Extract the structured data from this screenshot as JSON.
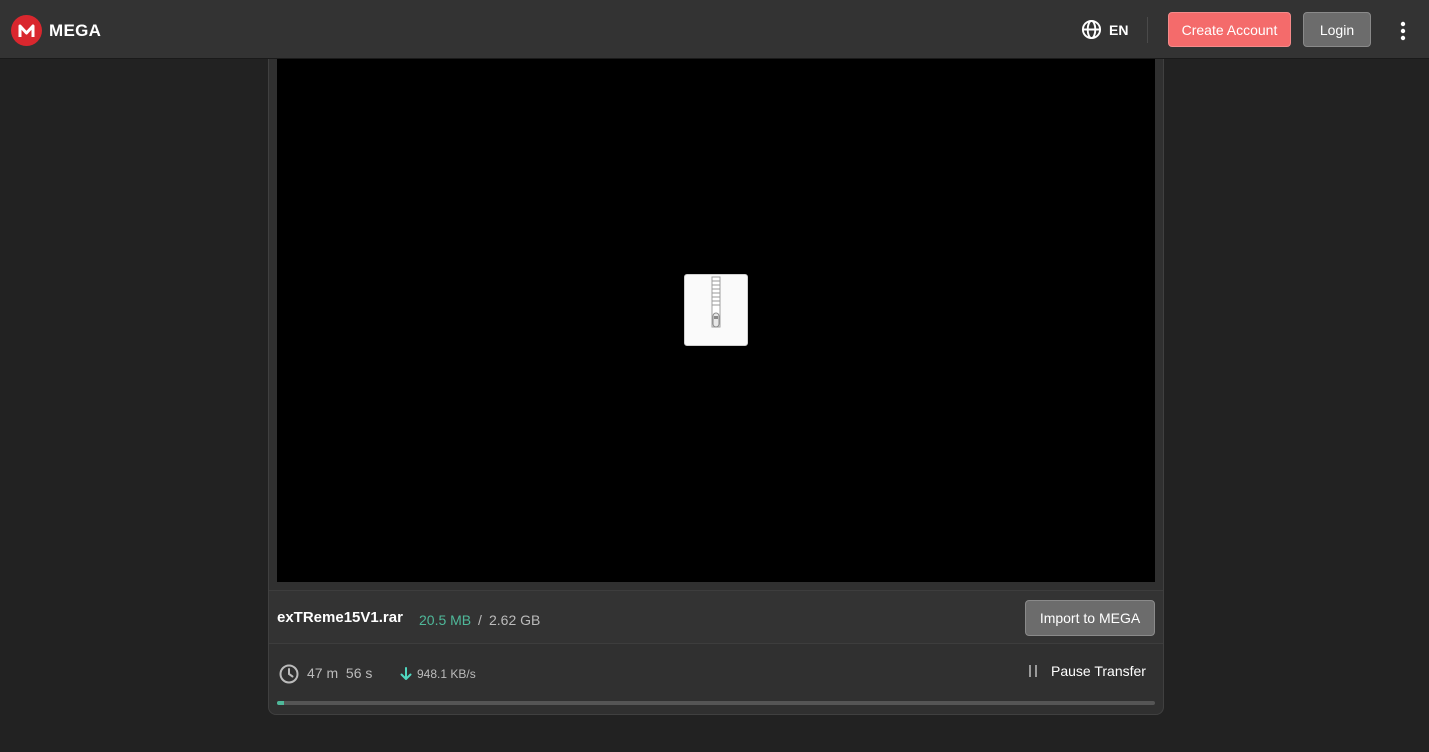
{
  "header": {
    "brand": "MEGA",
    "language": "EN",
    "create_account_label": "Create Account",
    "login_label": "Login",
    "icons": {
      "logo": "mega-logo-icon",
      "language": "globe-icon",
      "menu": "kebab-menu-icon"
    }
  },
  "file": {
    "name": "exTReme15V1.rar",
    "downloaded": "20.5 MB",
    "separator": "/",
    "total": "2.62 GB",
    "preview_icon": "archive-file-icon"
  },
  "actions": {
    "import_label": "Import to MEGA",
    "pause_label": "Pause Transfer"
  },
  "transfer": {
    "time_remaining": "47 m  56 s",
    "speed": "948.1 KB/s",
    "progress_fraction": 0.0076
  },
  "colors": {
    "accent_red": "#d9272e",
    "create_account_bg": "#f46b6b",
    "downloaded_text": "#4fb89a",
    "speed_arrow": "#4fd8c0"
  }
}
